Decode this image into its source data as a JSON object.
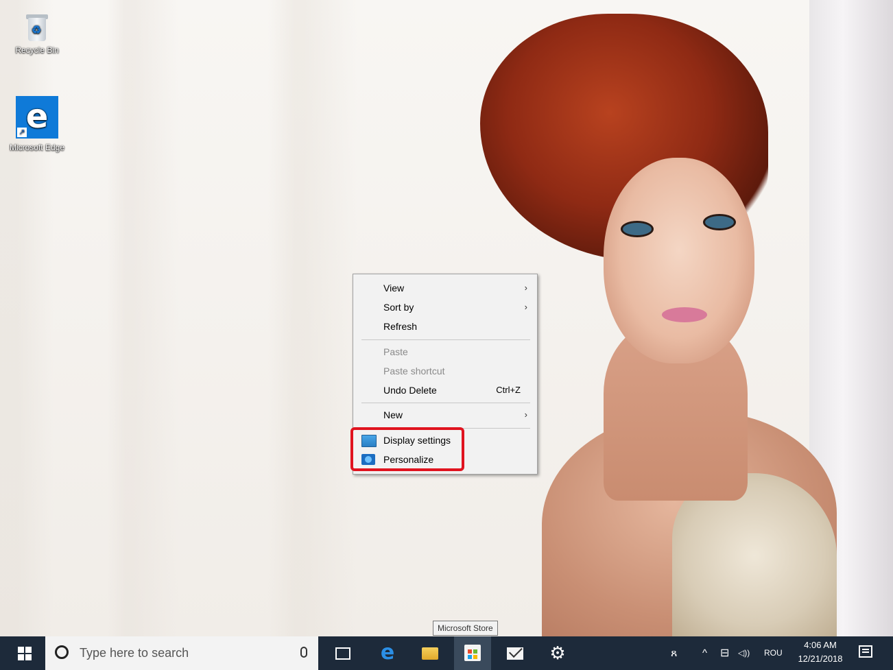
{
  "desktop": {
    "icons": [
      {
        "label": "Recycle Bin",
        "icon": "recycle-bin-icon"
      },
      {
        "label": "Microsoft Edge",
        "icon": "edge-icon"
      }
    ]
  },
  "context_menu": {
    "items": {
      "view": {
        "label": "View",
        "submenu": true
      },
      "sort_by": {
        "label": "Sort by",
        "submenu": true
      },
      "refresh": {
        "label": "Refresh"
      },
      "paste": {
        "label": "Paste",
        "disabled": true
      },
      "paste_shortcut": {
        "label": "Paste shortcut",
        "disabled": true
      },
      "undo_delete": {
        "label": "Undo Delete",
        "shortcut": "Ctrl+Z"
      },
      "new": {
        "label": "New",
        "submenu": true
      },
      "display_settings": {
        "label": "Display settings",
        "icon": "display-settings-icon"
      },
      "personalize": {
        "label": "Personalize",
        "icon": "personalize-icon"
      }
    },
    "submenu_arrow": "›",
    "highlight_color": "#e0131f"
  },
  "tooltip": {
    "text": "Microsoft Store"
  },
  "taskbar": {
    "search_placeholder": "Type here to search",
    "pinned": [
      "task-view",
      "microsoft-edge",
      "file-explorer",
      "microsoft-store",
      "mail",
      "settings"
    ],
    "tray": {
      "people": "ጸ",
      "chevron": "^",
      "network": "⊟",
      "volume": "◁))",
      "language": "ROU"
    },
    "clock": {
      "time": "4:06 AM",
      "date": "12/21/2018"
    },
    "background": "#1d2a3a"
  }
}
